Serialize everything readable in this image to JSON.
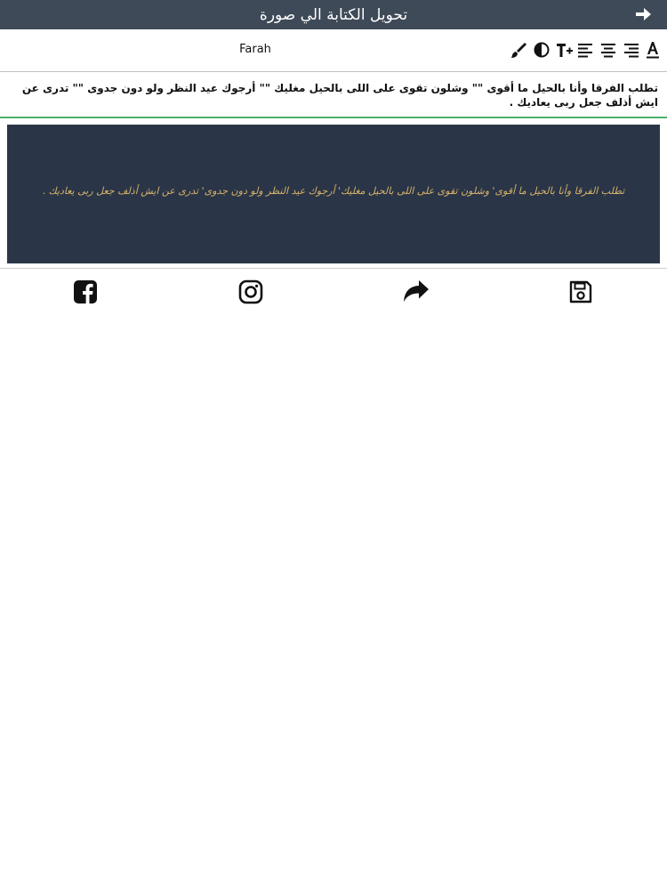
{
  "header": {
    "title": "تحويل الكتابة الي صورة",
    "back_icon": "arrow-right-icon"
  },
  "toolbar": {
    "font_name": "Farah",
    "tools": [
      "text-color-icon",
      "align-right-icon",
      "align-center-icon",
      "align-left-icon",
      "font-size-icon",
      "contrast-icon",
      "brush-icon"
    ]
  },
  "editor": {
    "text": "تطلب الفرقا وأنا بالحيل ما أقوى \"\" وشلون تقوى على اللى بالحيل مغليك \"\" أرجوك عيد النظر ولو دون جدوى \"\" تدرى عن ايش      أذلف جعل ربى يعاديك ."
  },
  "preview": {
    "text": "تطلب الفرقا وأنا بالحيل ما أقوى' وشلون تقوى على اللى بالحيل مغليك' أرجوك عيد النظر ولو دون جدوى' تدرى عن ايش      أذلف جعل ربى يعاديك .",
    "background": "#2a3547",
    "text_color": "#d8b36a"
  },
  "actions": [
    "facebook-icon",
    "instagram-icon",
    "share-icon",
    "save-icon"
  ],
  "colors": {
    "header_bg": "#3e4a57",
    "accent_line": "#4caf6a"
  }
}
